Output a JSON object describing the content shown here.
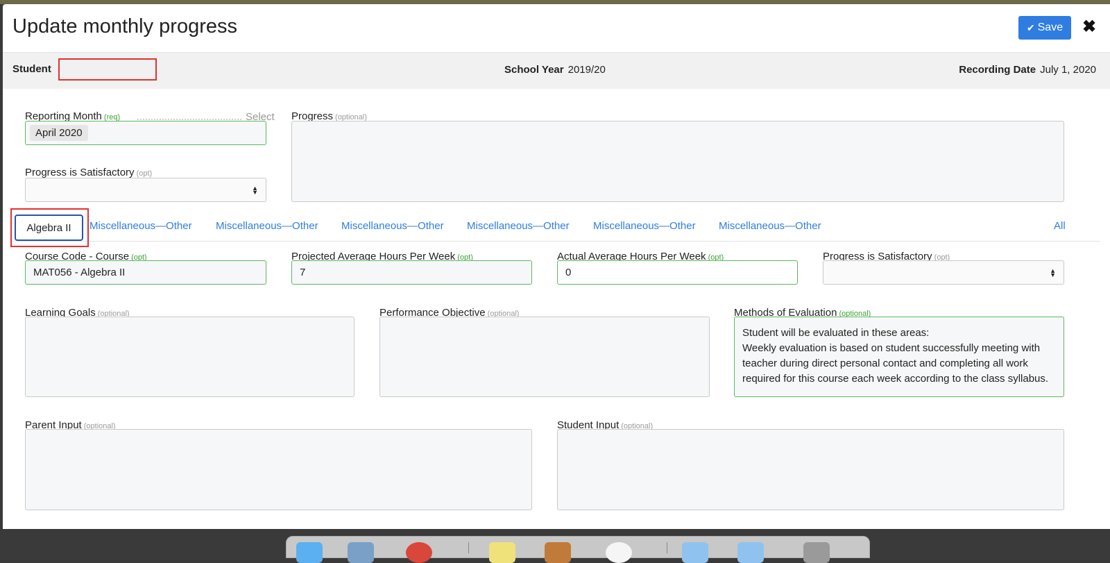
{
  "modal": {
    "title": "Update monthly progress",
    "save_label": "Save",
    "close_symbol": "✖"
  },
  "info_bar": {
    "student_label": "Student",
    "student_value": "",
    "school_year_label": "School Year",
    "school_year_value": "2019/20",
    "recording_date_label": "Recording Date",
    "recording_date_value": "July 1, 2020"
  },
  "top_form": {
    "reporting_month_label": "Reporting Month",
    "reporting_month_hint": "(req)",
    "reporting_month_select": "Select",
    "reporting_month_value": "April 2020",
    "progress_label": "Progress",
    "progress_hint": "(optional)",
    "satisfactory_label": "Progress is Satisfactory",
    "satisfactory_hint": "(opt)"
  },
  "tabs": {
    "active": "Algebra II",
    "items": [
      "Miscellaneous—Other",
      "Miscellaneous—Other",
      "Miscellaneous—Other",
      "Miscellaneous—Other",
      "Miscellaneous—Other",
      "Miscellaneous—Other"
    ],
    "all_label": "All"
  },
  "course": {
    "course_code_label": "Course Code - Course",
    "course_code_hint": "(opt)",
    "course_code_value": "MAT056 - Algebra II",
    "projected_label": "Projected Average Hours Per Week",
    "projected_hint": "(opt)",
    "projected_value": "7",
    "actual_label": "Actual Average Hours Per Week",
    "actual_hint": "(opt)",
    "actual_value": "0",
    "satisfactory_label": "Progress is Satisfactory",
    "satisfactory_hint": "(opt)",
    "learning_goals_label": "Learning Goals",
    "learning_goals_hint": "(optional)",
    "performance_label": "Performance Objective",
    "performance_hint": "(optional)",
    "methods_label": "Methods of Evaluation",
    "methods_hint": "(optional)",
    "methods_line1": "Student will be evaluated in these areas:",
    "methods_line2": "Weekly evaluation is based on student successfully meeting with teacher during direct personal contact and completing all work required for this course each week according to the class syllabus.",
    "parent_label": "Parent Input",
    "parent_hint": "(optional)",
    "student_input_label": "Student Input",
    "student_input_hint": "(optional)"
  },
  "colors": {
    "accent": "#2f7de1",
    "valid_border": "#5cb85c",
    "highlight_red": "#e53030"
  }
}
